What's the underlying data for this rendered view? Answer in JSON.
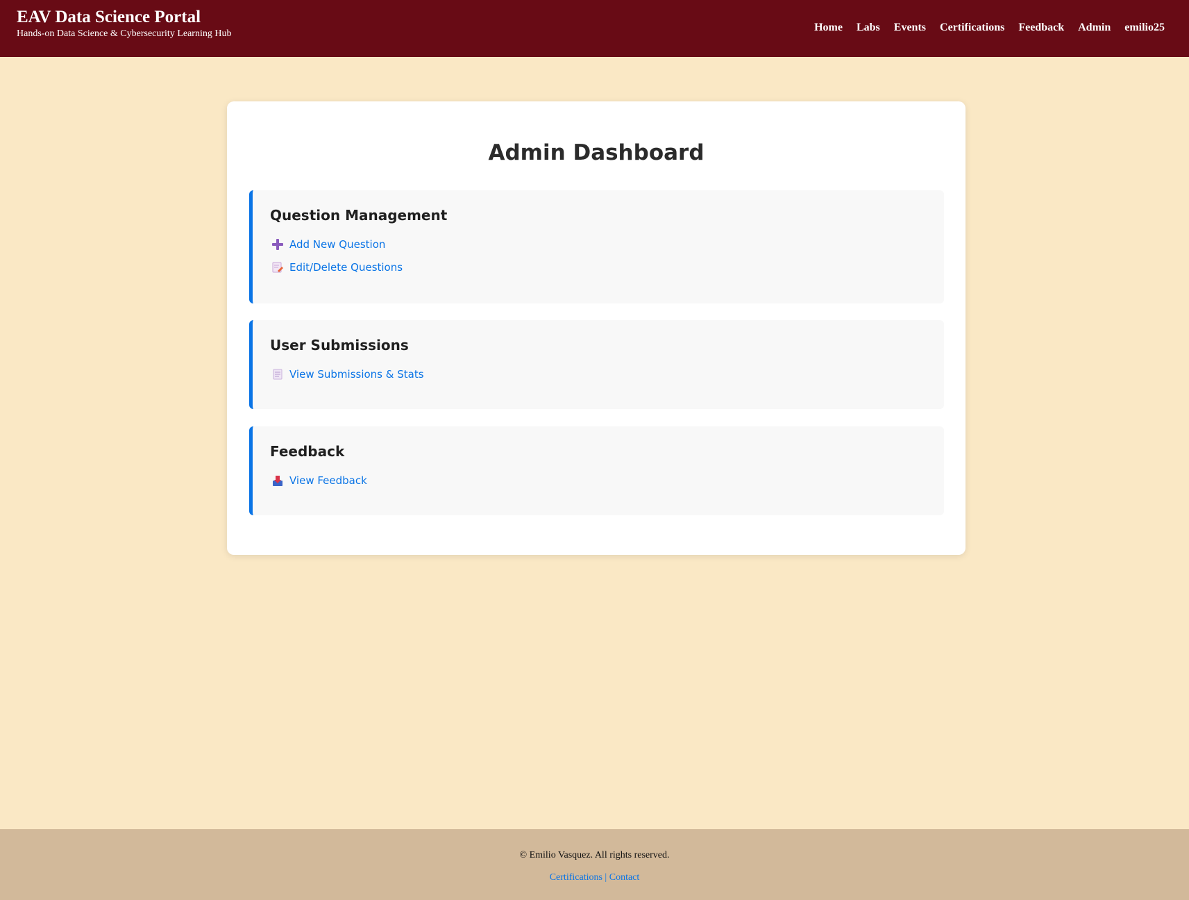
{
  "header": {
    "title": "EAV Data Science Portal",
    "subtitle": "Hands-on Data Science & Cybersecurity Learning Hub",
    "nav": [
      "Home",
      "Labs",
      "Events",
      "Certifications",
      "Feedback",
      "Admin",
      "emilio25"
    ]
  },
  "main": {
    "title": "Admin Dashboard",
    "sections": [
      {
        "heading": "Question Management",
        "links": [
          {
            "label": "Add New Question",
            "icon": "plus-icon"
          },
          {
            "label": "Edit/Delete Questions",
            "icon": "edit-icon"
          }
        ]
      },
      {
        "heading": "User Submissions",
        "links": [
          {
            "label": "View Submissions & Stats",
            "icon": "document-icon"
          }
        ]
      },
      {
        "heading": "Feedback",
        "links": [
          {
            "label": "View Feedback",
            "icon": "inbox-icon"
          }
        ]
      }
    ]
  },
  "footer": {
    "copyright": "© Emilio Vasquez. All rights reserved.",
    "links": [
      "Certifications",
      "Contact"
    ],
    "separator": "|"
  },
  "colors": {
    "header_bg": "#680b15",
    "page_bg": "#fae8c5",
    "accent": "#0a74e6",
    "footer_bg": "#d2b99a"
  }
}
